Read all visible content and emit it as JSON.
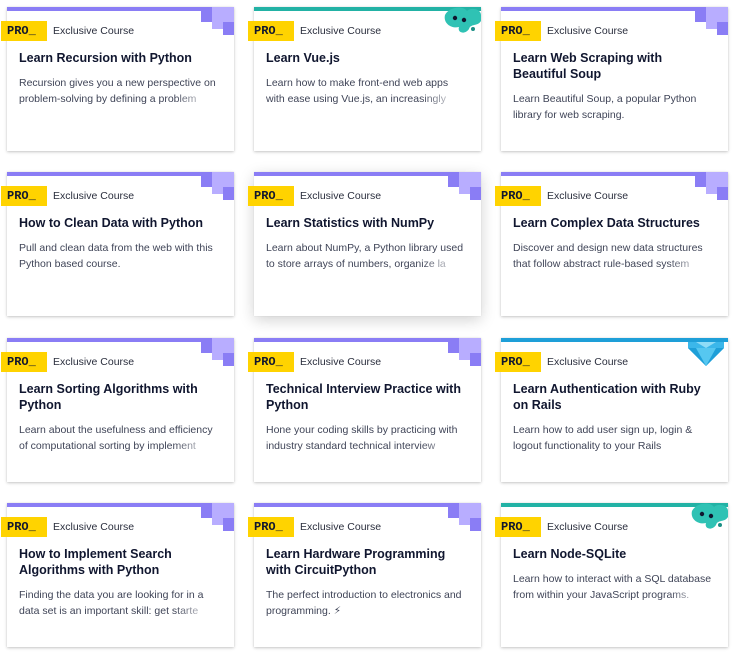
{
  "colors": {
    "purple": "#8a7df5",
    "purple_light": "#b8adff",
    "teal": "#22b2a5",
    "blue": "#1e9fd8",
    "badge": "#ffd300",
    "text": "#10162f"
  },
  "courses": [
    {
      "badge": "PRO_",
      "tag": "Exclusive Course",
      "title": "Learn Recursion with Python",
      "description": "Recursion gives you a new perspective on problem-solving by defining a problem",
      "bar": "purple",
      "deco": "pixel"
    },
    {
      "badge": "PRO_",
      "tag": "Exclusive Course",
      "title": "Learn Vue.js",
      "description": "Learn how to make front-end web apps with ease using Vue.js, an increasingly",
      "bar": "teal",
      "deco": "blob"
    },
    {
      "badge": "PRO_",
      "tag": "Exclusive Course",
      "title": "Learn Web Scraping with Beautiful Soup",
      "description": "Learn Beautiful Soup, a popular Python library for web scraping.",
      "bar": "purple",
      "deco": "pixel"
    },
    {
      "badge": "PRO_",
      "tag": "Exclusive Course",
      "title": "How to Clean Data with Python",
      "description": "Pull and clean data from the web with this Python based course.",
      "bar": "purple",
      "deco": "pixel"
    },
    {
      "badge": "PRO_",
      "tag": "Exclusive Course",
      "title": "Learn Statistics with NumPy",
      "description": "Learn about NumPy, a Python library used to store arrays of numbers, organize la",
      "bar": "purple",
      "deco": "pixel"
    },
    {
      "badge": "PRO_",
      "tag": "Exclusive Course",
      "title": "Learn Complex Data Structures",
      "description": "Discover and design new data structures that follow abstract rule-based system",
      "bar": "purple",
      "deco": "pixel"
    },
    {
      "badge": "PRO_",
      "tag": "Exclusive Course",
      "title": "Learn Sorting Algorithms with Python",
      "description": "Learn about the usefulness and efficiency of computational sorting by implement",
      "bar": "purple",
      "deco": "pixel"
    },
    {
      "badge": "PRO_",
      "tag": "Exclusive Course",
      "title": "Technical Interview Practice with Python",
      "description": "Hone your coding skills by practicing with industry standard technical interview",
      "bar": "purple",
      "deco": "pixel"
    },
    {
      "badge": "PRO_",
      "tag": "Exclusive Course",
      "title": "Learn Authentication with Ruby on Rails",
      "description": "Learn how to add user sign up, login & logout functionality to your Rails",
      "bar": "blue",
      "deco": "gem"
    },
    {
      "badge": "PRO_",
      "tag": "Exclusive Course",
      "title": "How to Implement Search Algorithms with Python",
      "description": "Finding the data you are looking for in a data set is an important skill: get starte",
      "bar": "purple",
      "deco": "pixel"
    },
    {
      "badge": "PRO_",
      "tag": "Exclusive Course",
      "title": "Learn Hardware Programming with CircuitPython",
      "description": "The perfect introduction to electronics and programming. ⚡",
      "bar": "purple",
      "deco": "pixel"
    },
    {
      "badge": "PRO_",
      "tag": "Exclusive Course",
      "title": "Learn Node-SQLite",
      "description": "Learn how to interact with a SQL database from within your JavaScript programs.",
      "bar": "teal",
      "deco": "blob"
    }
  ]
}
